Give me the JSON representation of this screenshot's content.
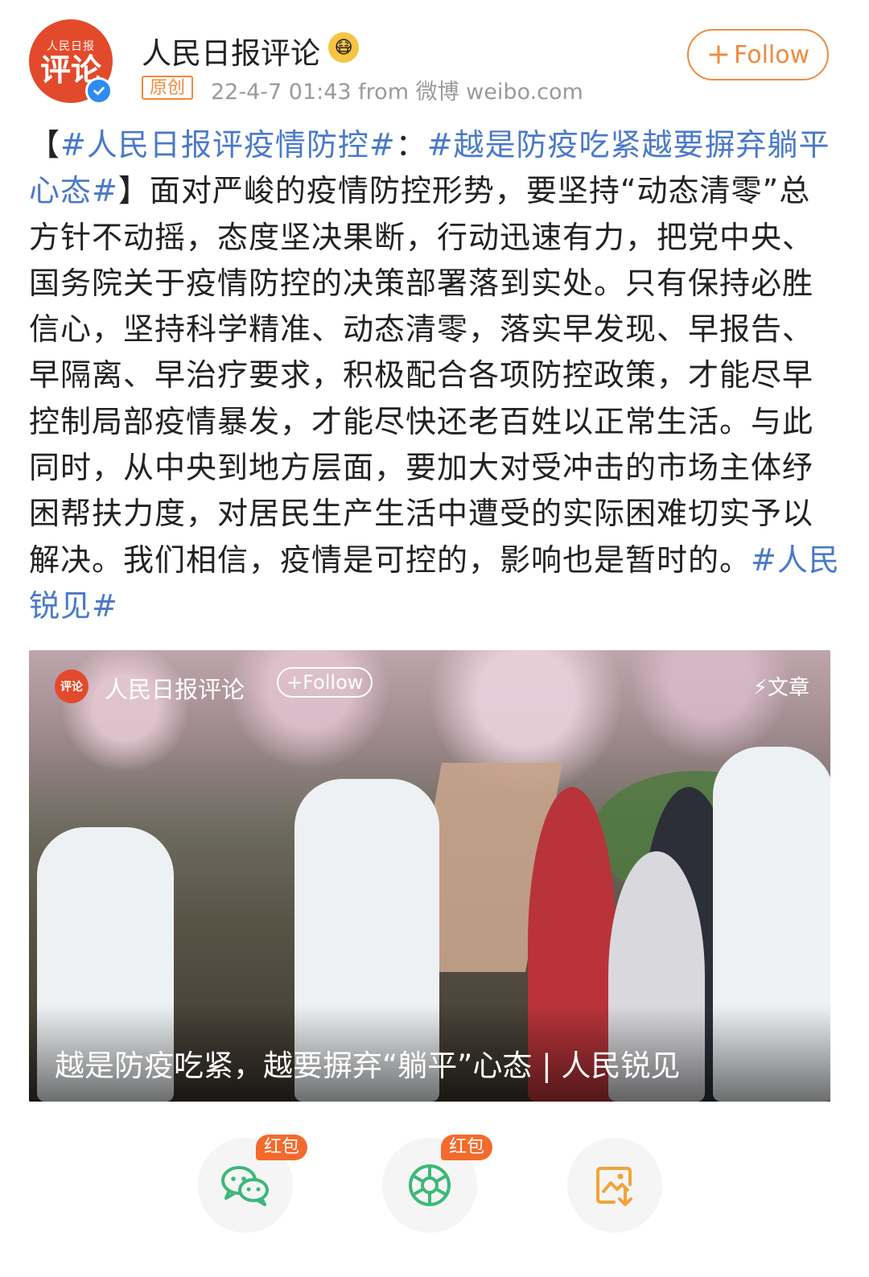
{
  "header": {
    "avatar_top_text": "人民日报",
    "avatar_main_text": "评论",
    "account_name": "人民日报评论",
    "original_tag": "原创",
    "meta": "22-4-7 01:43  from 微博 weibo.com",
    "follow_label": "Follow",
    "follow_plus": "+"
  },
  "post": {
    "bracket_open": "【",
    "tag1": "#人民日报评疫情防控#",
    "colon": "：",
    "tag2": "#越是防疫吃紧越要摒弃躺平心态#",
    "bracket_close": "】",
    "body": "面对严峻的疫情防控形势，要坚持“动态清零”总方针不动摇，态度坚决果断，行动迅速有力，把党中央、国务院关于疫情防控的决策部署落到实处。只有保持必胜信心，坚持科学精准、动态清零，落实早发现、早报告、早隔离、早治疗要求，积极配合各项防控政策，才能尽早控制局部疫情暴发，才能尽快还老百姓以正常生活。与此同时，从中央到地方层面，要加大对受冲击的市场主体纾困帮扶力度，对居民生产生活中遭受的实际困难切实予以解决。我们相信，疫情是可控的，影响也是暂时的。",
    "tag3": "#人民锐见#"
  },
  "card": {
    "avatar_text": "评论",
    "name": "人民日报评论",
    "follow_label": "+Follow",
    "type_label": "⚡文章",
    "title": "越是防疫吃紧，越要摒弃“躺平”心态 | 人民锐见"
  },
  "share": {
    "badge1": "红包",
    "badge2": "红包"
  },
  "colors": {
    "accent_orange": "#f08a3e",
    "link_blue": "#4a7ac9",
    "brand_red": "#e24a2b",
    "wechat_green": "#3cb878",
    "save_orange": "#f2a33a"
  }
}
